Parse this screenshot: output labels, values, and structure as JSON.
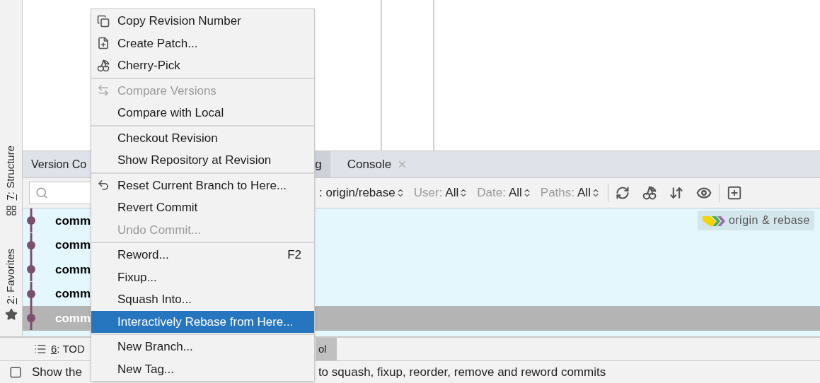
{
  "side_strip": [
    {
      "mnemonic": "7",
      "label": ": Structure"
    },
    {
      "mnemonic": "2",
      "label": ": Favorites"
    }
  ],
  "tool_window": {
    "title": "Version Co",
    "tabs": [
      {
        "label": "g",
        "selected": true,
        "closable": false
      },
      {
        "label": "Console",
        "selected": false,
        "closable": true
      }
    ]
  },
  "toolbar": {
    "branch": ": origin/rebase",
    "filters": [
      {
        "label": "User:",
        "value": "All"
      },
      {
        "label": "Date:",
        "value": "All"
      },
      {
        "label": "Paths:",
        "value": "All"
      }
    ]
  },
  "commits": [
    {
      "subject": "comm",
      "selected": false,
      "ref": "origin & rebase"
    },
    {
      "subject": "comm",
      "selected": false
    },
    {
      "subject": "comm",
      "selected": false
    },
    {
      "subject": "comm",
      "selected": false
    },
    {
      "subject": "comm",
      "selected": true
    }
  ],
  "bottom_tools": [
    {
      "mnemonic": "6",
      "label": ": TOD",
      "selected": false
    },
    {
      "label": "ol",
      "selected": true
    }
  ],
  "status_bar": {
    "left": "Show the",
    "right": "to squash, fixup, reorder, remove and reword commits"
  },
  "context_menu": {
    "groups": [
      {
        "items": [
          {
            "label": "Copy Revision Number",
            "disabled": false,
            "selected": false
          },
          {
            "label": "Create Patch...",
            "disabled": false,
            "selected": false
          },
          {
            "label": "Cherry-Pick",
            "disabled": false,
            "selected": false
          }
        ]
      },
      {
        "items": [
          {
            "label": "Compare Versions",
            "disabled": true,
            "selected": false
          },
          {
            "label": "Compare with Local",
            "disabled": false,
            "selected": false
          }
        ]
      },
      {
        "items": [
          {
            "label": "Checkout Revision",
            "disabled": false,
            "selected": false
          },
          {
            "label": "Show Repository at Revision",
            "disabled": false,
            "selected": false
          }
        ]
      },
      {
        "items": [
          {
            "label": "Reset Current Branch to Here...",
            "disabled": false,
            "selected": false
          },
          {
            "label": "Revert Commit",
            "disabled": false,
            "selected": false
          },
          {
            "label": "Undo Commit...",
            "disabled": true,
            "selected": false
          }
        ]
      },
      {
        "items": [
          {
            "label": "Reword...",
            "shortcut": "F2",
            "disabled": false,
            "selected": false
          },
          {
            "label": "Fixup...",
            "disabled": false,
            "selected": false
          },
          {
            "label": "Squash Into...",
            "disabled": false,
            "selected": false
          },
          {
            "label": "Interactively Rebase from Here...",
            "disabled": false,
            "selected": true
          }
        ]
      },
      {
        "items": [
          {
            "label": "New Branch...",
            "disabled": false,
            "selected": false
          },
          {
            "label": "New Tag...",
            "disabled": false,
            "selected": false
          }
        ]
      }
    ]
  }
}
